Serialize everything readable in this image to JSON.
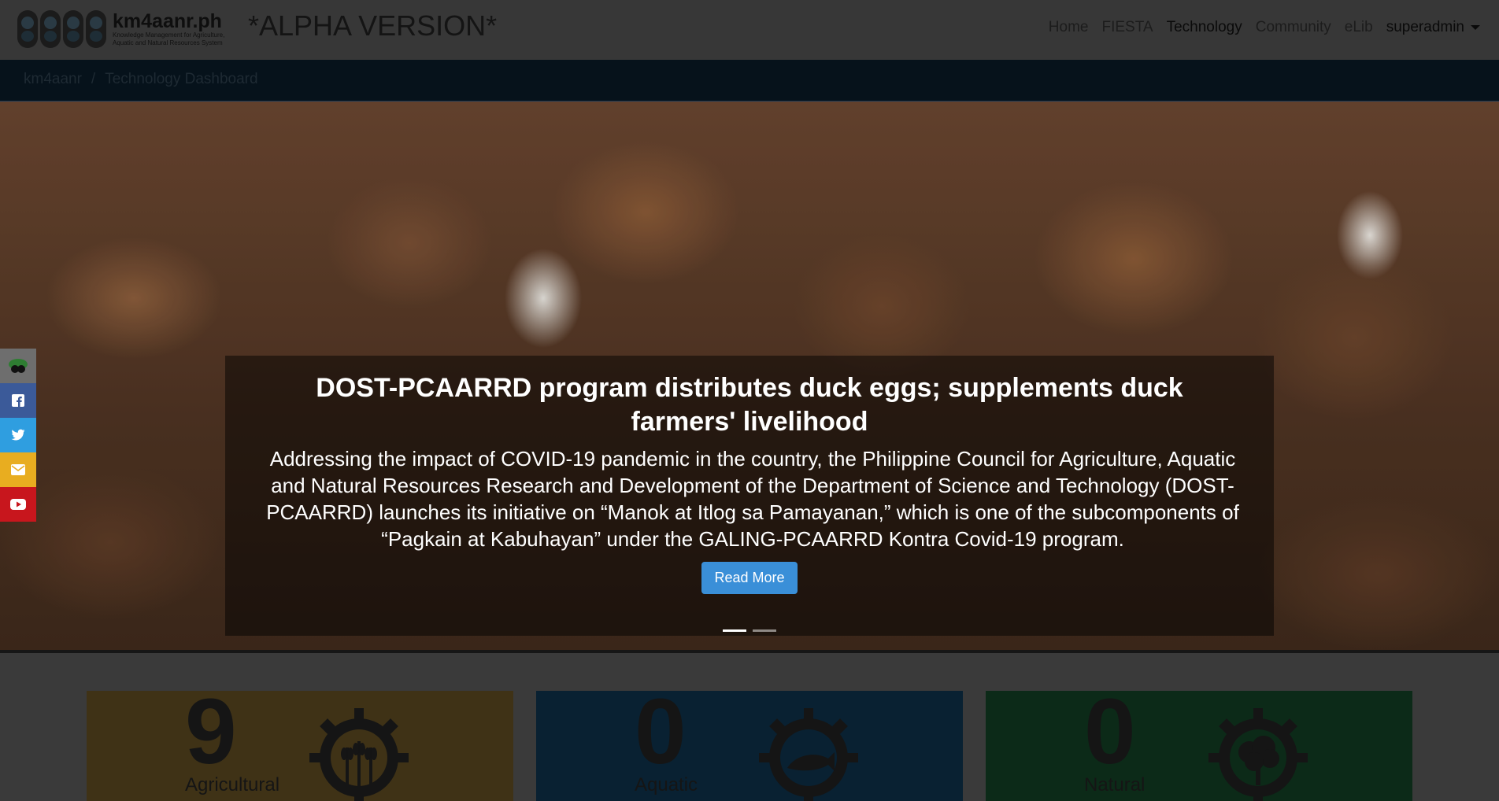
{
  "navbar": {
    "brand_title": "km4aanr.ph",
    "brand_subtitle_1": "Knowledge Management for Agriculture,",
    "brand_subtitle_2": "Aquatic and Natural Resources System",
    "alpha": "*ALPHA VERSION*",
    "links": [
      "Home",
      "FIESTA",
      "Technology",
      "Community",
      "eLib"
    ],
    "user": "superadmin"
  },
  "breadcrumb": {
    "root": "km4aanr",
    "separator": "/",
    "current": "Technology Dashboard"
  },
  "hero": {
    "title": "DOST-PCAARRD program distributes duck eggs; supplements duck farmers' livelihood",
    "text": "Addressing the impact of COVID-19 pandemic in the country, the Philippine Council for Agriculture, Aquatic and Natural Resources Research and Development of the Department of Science and Technology (DOST-PCAARRD) launches its initiative on “Manok at Itlog sa Pamayanan,” which is one of the subcomponents of “Pagkain at Kabuhayan” under the GALING-PCAARRD Kontra Covid-19 program.",
    "button": "Read More"
  },
  "social": {
    "facebook": "f",
    "twitter": "t",
    "email": "@",
    "youtube": "▶"
  },
  "cards": [
    {
      "count": "9",
      "label": "Agricultural",
      "icon": "wheat-gear-icon",
      "color": "#e5a21a"
    },
    {
      "count": "0",
      "label": "Aquatic",
      "icon": "fish-gear-icon",
      "color": "#1e88d6"
    },
    {
      "count": "0",
      "label": "Natural",
      "icon": "tree-gear-icon",
      "color": "#2eaa52"
    }
  ]
}
